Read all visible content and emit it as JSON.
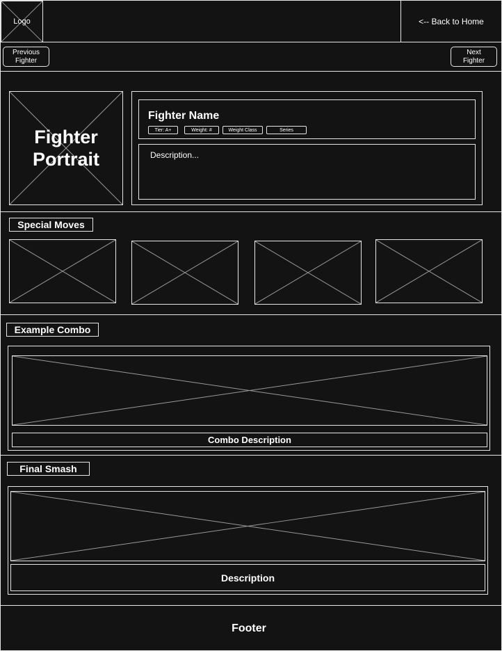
{
  "header": {
    "logo": "Logo",
    "back_link": "<-- Back to Home"
  },
  "nav": {
    "previous": "Previous\nFighter",
    "next": "Next\nFighter"
  },
  "fighter": {
    "portrait": "Fighter Portrait",
    "name": "Fighter Name",
    "tags": [
      "Tier: A+",
      "Weight: #",
      "Weight Class",
      "Series"
    ],
    "description": "Description..."
  },
  "special_moves": {
    "title": "Special Moves"
  },
  "combo": {
    "title": "Example Combo",
    "description": "Combo Description"
  },
  "final_smash": {
    "title": "Final Smash",
    "description": "Description"
  },
  "footer": {
    "text": "Footer"
  }
}
